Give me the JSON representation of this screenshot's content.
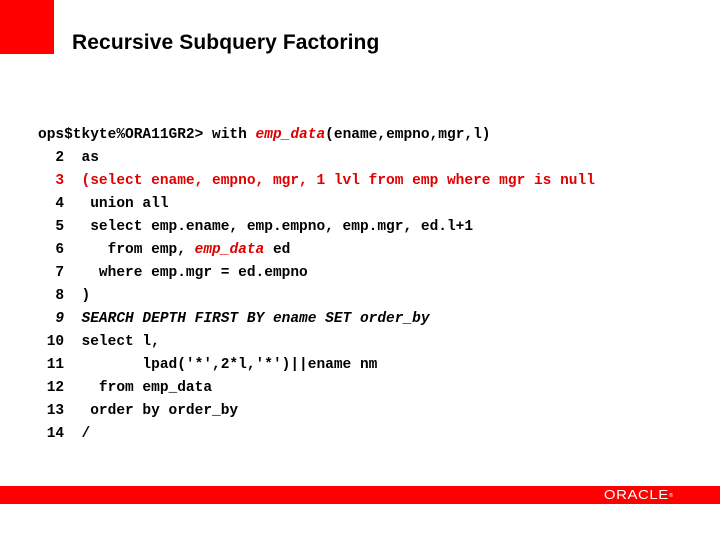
{
  "slide": {
    "title": "Recursive Subquery Factoring",
    "accent_color": "#ff0000"
  },
  "code": {
    "prompt": "ops$tkyte%ORA11GR2> ",
    "lines": [
      {
        "num": "",
        "segments": [
          {
            "text": "ops$tkyte%ORA11GR2> with ",
            "style": "normal"
          },
          {
            "text": "emp_data",
            "style": "red-italic"
          },
          {
            "text": "(ename,empno,mgr,l)",
            "style": "normal"
          }
        ]
      },
      {
        "num": "  2",
        "segments": [
          {
            "text": "  as",
            "style": "normal"
          }
        ]
      },
      {
        "num": "  3",
        "segments": [
          {
            "text": "  (select ename, empno, mgr, 1 lvl from emp where mgr is null",
            "style": "red"
          }
        ]
      },
      {
        "num": "  4",
        "segments": [
          {
            "text": "   union all",
            "style": "normal"
          }
        ]
      },
      {
        "num": "  5",
        "segments": [
          {
            "text": "   select emp.ename, emp.empno, emp.mgr, ed.l+1",
            "style": "normal"
          }
        ]
      },
      {
        "num": "  6",
        "segments": [
          {
            "text": "     from emp, ",
            "style": "normal"
          },
          {
            "text": "emp_data",
            "style": "red-italic"
          },
          {
            "text": " ed",
            "style": "normal"
          }
        ]
      },
      {
        "num": "  7",
        "segments": [
          {
            "text": "    where emp.mgr = ed.empno",
            "style": "normal"
          }
        ]
      },
      {
        "num": "  8",
        "segments": [
          {
            "text": "  )",
            "style": "normal"
          }
        ]
      },
      {
        "num": "  9",
        "segments": [
          {
            "text": "  SEARCH DEPTH FIRST BY ename SET order_by",
            "style": "italic"
          }
        ]
      },
      {
        "num": " 10",
        "segments": [
          {
            "text": "  select l,",
            "style": "normal"
          }
        ]
      },
      {
        "num": " 11",
        "segments": [
          {
            "text": "         lpad('*',2*l,'*')||ename nm",
            "style": "normal"
          }
        ]
      },
      {
        "num": " 12",
        "segments": [
          {
            "text": "    from emp_data",
            "style": "normal"
          }
        ]
      },
      {
        "num": " 13",
        "segments": [
          {
            "text": "   order by order_by",
            "style": "normal"
          }
        ]
      },
      {
        "num": " 14",
        "segments": [
          {
            "text": "  /",
            "style": "normal"
          }
        ]
      }
    ],
    "highlight_color": "#e00000"
  },
  "footer": {
    "logo_text": "ORACLE",
    "logo_mark": "®",
    "bar_color": "#ff0000"
  }
}
